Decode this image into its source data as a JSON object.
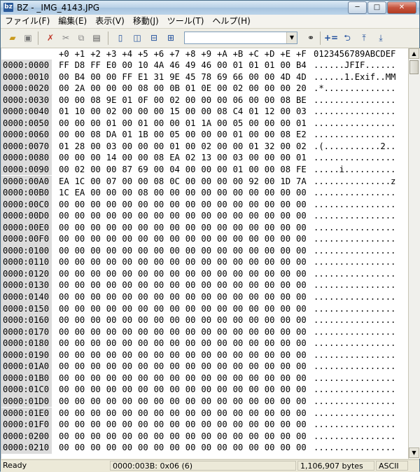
{
  "titlebar": {
    "title": "BZ - _IMG_4143.JPG"
  },
  "menu": [
    "ファイル(F)",
    "編集(E)",
    "表示(V)",
    "移動(J)",
    "ツール(T)",
    "ヘルプ(H)"
  ],
  "toolbar": {
    "combo_value": ""
  },
  "header": {
    "cols": [
      "+0",
      "+1",
      "+2",
      "+3",
      "+4",
      "+5",
      "+6",
      "+7",
      "+8",
      "+9",
      "+A",
      "+B",
      "+C",
      "+D",
      "+E",
      "+F"
    ],
    "ascii": "0123456789ABCDEF"
  },
  "rows": [
    {
      "addr": "0000:0000",
      "hex": [
        "FF",
        "D8",
        "FF",
        "E0",
        "00",
        "10",
        "4A",
        "46",
        "49",
        "46",
        "00",
        "01",
        "01",
        "01",
        "00",
        "B4"
      ],
      "ascii": "......JFIF......"
    },
    {
      "addr": "0000:0010",
      "hex": [
        "00",
        "B4",
        "00",
        "00",
        "FF",
        "E1",
        "31",
        "9E",
        "45",
        "78",
        "69",
        "66",
        "00",
        "00",
        "4D",
        "4D"
      ],
      "ascii": "......1.Exif..MM"
    },
    {
      "addr": "0000:0020",
      "hex": [
        "00",
        "2A",
        "00",
        "00",
        "00",
        "08",
        "00",
        "0B",
        "01",
        "0E",
        "00",
        "02",
        "00",
        "00",
        "00",
        "20"
      ],
      "ascii": ".*.............."
    },
    {
      "addr": "0000:0030",
      "hex": [
        "00",
        "00",
        "08",
        "9E",
        "01",
        "0F",
        "00",
        "02",
        "00",
        "00",
        "00",
        "06",
        "00",
        "00",
        "08",
        "BE"
      ],
      "ascii": "................"
    },
    {
      "addr": "0000:0040",
      "hex": [
        "01",
        "10",
        "00",
        "02",
        "00",
        "00",
        "00",
        "15",
        "00",
        "00",
        "08",
        "C4",
        "01",
        "12",
        "00",
        "03"
      ],
      "ascii": "................"
    },
    {
      "addr": "0000:0050",
      "hex": [
        "00",
        "00",
        "00",
        "01",
        "00",
        "01",
        "00",
        "00",
        "01",
        "1A",
        "00",
        "05",
        "00",
        "00",
        "00",
        "01"
      ],
      "ascii": "................"
    },
    {
      "addr": "0000:0060",
      "hex": [
        "00",
        "00",
        "08",
        "DA",
        "01",
        "1B",
        "00",
        "05",
        "00",
        "00",
        "00",
        "01",
        "00",
        "00",
        "08",
        "E2"
      ],
      "ascii": "................"
    },
    {
      "addr": "0000:0070",
      "hex": [
        "01",
        "28",
        "00",
        "03",
        "00",
        "00",
        "00",
        "01",
        "00",
        "02",
        "00",
        "00",
        "01",
        "32",
        "00",
        "02"
      ],
      "ascii": ".(...........2.."
    },
    {
      "addr": "0000:0080",
      "hex": [
        "00",
        "00",
        "00",
        "14",
        "00",
        "00",
        "08",
        "EA",
        "02",
        "13",
        "00",
        "03",
        "00",
        "00",
        "00",
        "01"
      ],
      "ascii": "................"
    },
    {
      "addr": "0000:0090",
      "hex": [
        "00",
        "02",
        "00",
        "00",
        "87",
        "69",
        "00",
        "04",
        "00",
        "00",
        "00",
        "01",
        "00",
        "00",
        "08",
        "FE"
      ],
      "ascii": ".....i.........."
    },
    {
      "addr": "0000:00A0",
      "hex": [
        "EA",
        "1C",
        "00",
        "07",
        "00",
        "00",
        "08",
        "0C",
        "00",
        "00",
        "00",
        "00",
        "92",
        "00",
        "1D",
        "7A"
      ],
      "ascii": "...............z"
    },
    {
      "addr": "0000:00B0",
      "hex": [
        "1C",
        "EA",
        "00",
        "00",
        "00",
        "08",
        "00",
        "00",
        "00",
        "00",
        "00",
        "00",
        "00",
        "00",
        "00",
        "00"
      ],
      "ascii": "................"
    },
    {
      "addr": "0000:00C0",
      "hex": [
        "00",
        "00",
        "00",
        "00",
        "00",
        "00",
        "00",
        "00",
        "00",
        "00",
        "00",
        "00",
        "00",
        "00",
        "00",
        "00"
      ],
      "ascii": "................"
    },
    {
      "addr": "0000:00D0",
      "hex": [
        "00",
        "00",
        "00",
        "00",
        "00",
        "00",
        "00",
        "00",
        "00",
        "00",
        "00",
        "00",
        "00",
        "00",
        "00",
        "00"
      ],
      "ascii": "................"
    },
    {
      "addr": "0000:00E0",
      "hex": [
        "00",
        "00",
        "00",
        "00",
        "00",
        "00",
        "00",
        "00",
        "00",
        "00",
        "00",
        "00",
        "00",
        "00",
        "00",
        "00"
      ],
      "ascii": "................"
    },
    {
      "addr": "0000:00F0",
      "hex": [
        "00",
        "00",
        "00",
        "00",
        "00",
        "00",
        "00",
        "00",
        "00",
        "00",
        "00",
        "00",
        "00",
        "00",
        "00",
        "00"
      ],
      "ascii": "................"
    },
    {
      "addr": "0000:0100",
      "hex": [
        "00",
        "00",
        "00",
        "00",
        "00",
        "00",
        "00",
        "00",
        "00",
        "00",
        "00",
        "00",
        "00",
        "00",
        "00",
        "00"
      ],
      "ascii": "................"
    },
    {
      "addr": "0000:0110",
      "hex": [
        "00",
        "00",
        "00",
        "00",
        "00",
        "00",
        "00",
        "00",
        "00",
        "00",
        "00",
        "00",
        "00",
        "00",
        "00",
        "00"
      ],
      "ascii": "................"
    },
    {
      "addr": "0000:0120",
      "hex": [
        "00",
        "00",
        "00",
        "00",
        "00",
        "00",
        "00",
        "00",
        "00",
        "00",
        "00",
        "00",
        "00",
        "00",
        "00",
        "00"
      ],
      "ascii": "................"
    },
    {
      "addr": "0000:0130",
      "hex": [
        "00",
        "00",
        "00",
        "00",
        "00",
        "00",
        "00",
        "00",
        "00",
        "00",
        "00",
        "00",
        "00",
        "00",
        "00",
        "00"
      ],
      "ascii": "................"
    },
    {
      "addr": "0000:0140",
      "hex": [
        "00",
        "00",
        "00",
        "00",
        "00",
        "00",
        "00",
        "00",
        "00",
        "00",
        "00",
        "00",
        "00",
        "00",
        "00",
        "00"
      ],
      "ascii": "................"
    },
    {
      "addr": "0000:0150",
      "hex": [
        "00",
        "00",
        "00",
        "00",
        "00",
        "00",
        "00",
        "00",
        "00",
        "00",
        "00",
        "00",
        "00",
        "00",
        "00",
        "00"
      ],
      "ascii": "................"
    },
    {
      "addr": "0000:0160",
      "hex": [
        "00",
        "00",
        "00",
        "00",
        "00",
        "00",
        "00",
        "00",
        "00",
        "00",
        "00",
        "00",
        "00",
        "00",
        "00",
        "00"
      ],
      "ascii": "................"
    },
    {
      "addr": "0000:0170",
      "hex": [
        "00",
        "00",
        "00",
        "00",
        "00",
        "00",
        "00",
        "00",
        "00",
        "00",
        "00",
        "00",
        "00",
        "00",
        "00",
        "00"
      ],
      "ascii": "................"
    },
    {
      "addr": "0000:0180",
      "hex": [
        "00",
        "00",
        "00",
        "00",
        "00",
        "00",
        "00",
        "00",
        "00",
        "00",
        "00",
        "00",
        "00",
        "00",
        "00",
        "00"
      ],
      "ascii": "................"
    },
    {
      "addr": "0000:0190",
      "hex": [
        "00",
        "00",
        "00",
        "00",
        "00",
        "00",
        "00",
        "00",
        "00",
        "00",
        "00",
        "00",
        "00",
        "00",
        "00",
        "00"
      ],
      "ascii": "................"
    },
    {
      "addr": "0000:01A0",
      "hex": [
        "00",
        "00",
        "00",
        "00",
        "00",
        "00",
        "00",
        "00",
        "00",
        "00",
        "00",
        "00",
        "00",
        "00",
        "00",
        "00"
      ],
      "ascii": "................"
    },
    {
      "addr": "0000:01B0",
      "hex": [
        "00",
        "00",
        "00",
        "00",
        "00",
        "00",
        "00",
        "00",
        "00",
        "00",
        "00",
        "00",
        "00",
        "00",
        "00",
        "00"
      ],
      "ascii": "................"
    },
    {
      "addr": "0000:01C0",
      "hex": [
        "00",
        "00",
        "00",
        "00",
        "00",
        "00",
        "00",
        "00",
        "00",
        "00",
        "00",
        "00",
        "00",
        "00",
        "00",
        "00"
      ],
      "ascii": "................"
    },
    {
      "addr": "0000:01D0",
      "hex": [
        "00",
        "00",
        "00",
        "00",
        "00",
        "00",
        "00",
        "00",
        "00",
        "00",
        "00",
        "00",
        "00",
        "00",
        "00",
        "00"
      ],
      "ascii": "................"
    },
    {
      "addr": "0000:01E0",
      "hex": [
        "00",
        "00",
        "00",
        "00",
        "00",
        "00",
        "00",
        "00",
        "00",
        "00",
        "00",
        "00",
        "00",
        "00",
        "00",
        "00"
      ],
      "ascii": "................"
    },
    {
      "addr": "0000:01F0",
      "hex": [
        "00",
        "00",
        "00",
        "00",
        "00",
        "00",
        "00",
        "00",
        "00",
        "00",
        "00",
        "00",
        "00",
        "00",
        "00",
        "00"
      ],
      "ascii": "................"
    },
    {
      "addr": "0000:0200",
      "hex": [
        "00",
        "00",
        "00",
        "00",
        "00",
        "00",
        "00",
        "00",
        "00",
        "00",
        "00",
        "00",
        "00",
        "00",
        "00",
        "00"
      ],
      "ascii": "................"
    },
    {
      "addr": "0000:0210",
      "hex": [
        "00",
        "00",
        "00",
        "00",
        "00",
        "00",
        "00",
        "00",
        "00",
        "00",
        "00",
        "00",
        "00",
        "00",
        "00",
        "00"
      ],
      "ascii": "................"
    }
  ],
  "status": {
    "state": "Ready",
    "position": "0000:003B: 0x06 (6)",
    "filesize": "1,106,907 bytes",
    "encoding": "ASCII"
  }
}
